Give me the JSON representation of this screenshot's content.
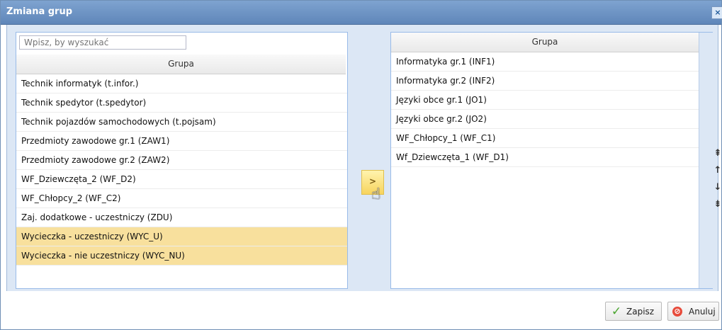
{
  "window": {
    "title": "Zmiana grup",
    "close_symbol": "×"
  },
  "left_panel": {
    "search_placeholder": "Wpisz, by wyszukać",
    "column_header": "Grupa",
    "items": [
      {
        "label": "Technik informatyk (t.infor.)",
        "selected": false
      },
      {
        "label": "Technik spedytor (t.spedytor)",
        "selected": false
      },
      {
        "label": "Technik pojazdów samochodowych (t.pojsam)",
        "selected": false
      },
      {
        "label": "Przedmioty zawodowe gr.1 (ZAW1)",
        "selected": false
      },
      {
        "label": "Przedmioty zawodowe gr.2 (ZAW2)",
        "selected": false
      },
      {
        "label": "WF_Dziewczęta_2 (WF_D2)",
        "selected": false
      },
      {
        "label": "WF_Chłopcy_2 (WF_C2)",
        "selected": false
      },
      {
        "label": "Zaj. dodatkowe - uczestniczy (ZDU)",
        "selected": false
      },
      {
        "label": "Wycieczka - uczestniczy (WYC_U)",
        "selected": true
      },
      {
        "label": "Wycieczka - nie uczestniczy (WYC_NU)",
        "selected": true
      }
    ]
  },
  "transfer_button": {
    "label": ">"
  },
  "right_panel": {
    "column_header": "Grupa",
    "items": [
      {
        "label": "Informatyka gr.1 (INF1)"
      },
      {
        "label": "Informatyka gr.2 (INF2)"
      },
      {
        "label": "Języki obce gr.1 (JO1)"
      },
      {
        "label": "Języki obce gr.2 (JO2)"
      },
      {
        "label": "WF_Chłopcy_1 (WF_C1)"
      },
      {
        "label": "Wf_Dziewczęta_1 (WF_D1)"
      }
    ]
  },
  "move_tools": [
    {
      "name": "move-top",
      "symbol": "⇞"
    },
    {
      "name": "move-up",
      "symbol": "↑"
    },
    {
      "name": "move-down",
      "symbol": "↓"
    },
    {
      "name": "move-bottom",
      "symbol": "⇟"
    }
  ],
  "footer": {
    "save_label": "Zapisz",
    "cancel_label": "Anuluj"
  },
  "colors": {
    "title_bar": "#6f93c4",
    "selected_row": "#f8e09d",
    "transfer_button": "#f7d45e",
    "save_icon": "#4aa52f",
    "cancel_icon": "#e74b3b"
  }
}
